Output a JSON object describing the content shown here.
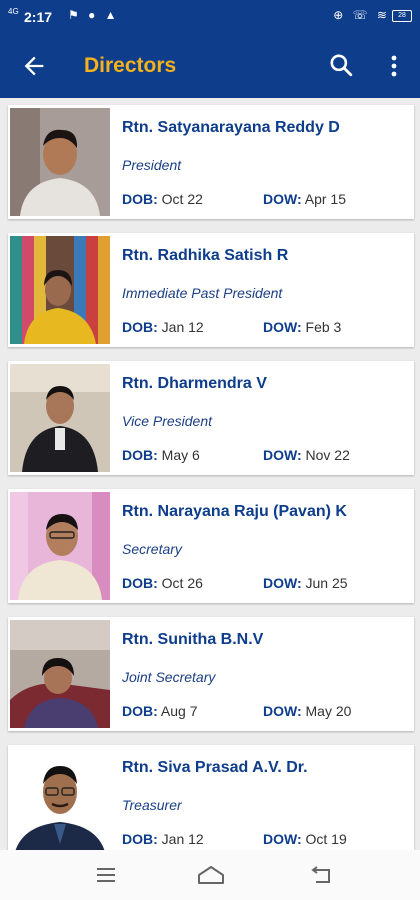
{
  "status": {
    "time": "2:17",
    "network": "4G",
    "battery": "28"
  },
  "appbar": {
    "title": "Directors",
    "back_icon": "arrow-left-icon",
    "search_icon": "search-icon",
    "more_icon": "more-vert-icon"
  },
  "labels": {
    "dob": "DOB:",
    "dow": "DOW:"
  },
  "directors": [
    {
      "name": "Rtn. Satyanarayana Reddy D",
      "role": "President",
      "dob": "Oct 22",
      "dow": "Apr 15"
    },
    {
      "name": "Rtn. Radhika Satish R",
      "role": "Immediate Past President",
      "dob": "Jan 12",
      "dow": "Feb 3"
    },
    {
      "name": "Rtn. Dharmendra V",
      "role": "Vice President",
      "dob": "May 6",
      "dow": "Nov 22"
    },
    {
      "name": "Rtn. Narayana Raju (Pavan) K",
      "role": "Secretary",
      "dob": "Oct 26",
      "dow": "Jun 25"
    },
    {
      "name": "Rtn. Sunitha B.N.V",
      "role": "Joint Secretary",
      "dob": "Aug 7",
      "dow": "May 20"
    },
    {
      "name": "Rtn. Siva Prasad A.V. Dr.",
      "role": "Treasurer",
      "dob": "Jan 12",
      "dow": "Oct 19"
    }
  ],
  "navbar": {
    "menu_icon": "menu-icon",
    "home_icon": "home-icon",
    "back_icon": "back-icon"
  },
  "colors": {
    "primary": "#0e3d8c",
    "accent": "#f5b21b"
  }
}
